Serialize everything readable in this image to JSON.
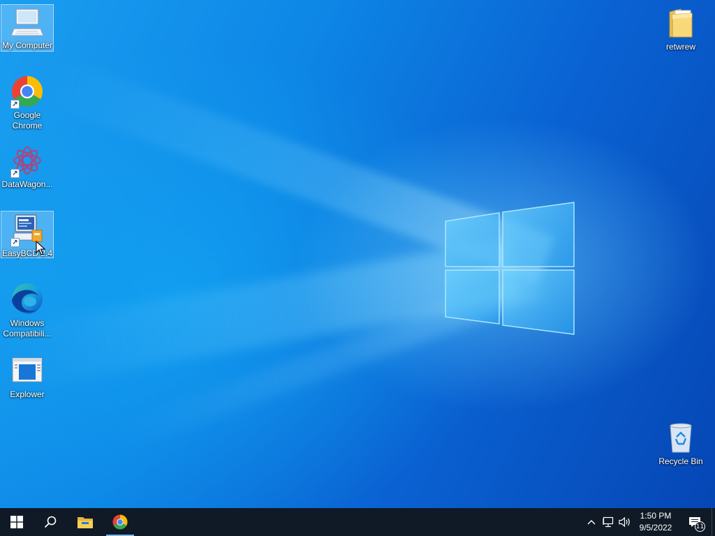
{
  "desktop": {
    "icons": [
      {
        "label": "My Computer",
        "icon": "computer-icon",
        "selected": true
      },
      {
        "label": "Google Chrome",
        "icon": "chrome-icon",
        "shortcut": true
      },
      {
        "label": "DataWagon...",
        "icon": "datawagon-icon",
        "shortcut": true
      },
      {
        "label": "EasyBCD 2.4",
        "icon": "easybcd-icon",
        "shortcut": true,
        "selected": true
      },
      {
        "label": "Windows Compatibili...",
        "icon": "edge-icon"
      },
      {
        "label": "Explower",
        "icon": "explower-icon"
      },
      {
        "label": "retwrew",
        "icon": "folder-icon"
      },
      {
        "label": "Recycle Bin",
        "icon": "recycle-bin-icon"
      }
    ]
  },
  "taskbar": {
    "buttons": [
      "start-icon",
      "search-icon",
      "file-explorer-icon",
      "chrome-icon"
    ],
    "active_app": "chrome-icon",
    "tray": {
      "icons": [
        "chevron-up-icon",
        "network-icon",
        "volume-icon"
      ],
      "time": "1:50 PM",
      "date": "9/5/2022",
      "notification_count": "11"
    }
  },
  "colors": {
    "taskbar": "#101a26",
    "desktop_accent": "#0a78e0",
    "active_indicator": "#76b9ed"
  }
}
